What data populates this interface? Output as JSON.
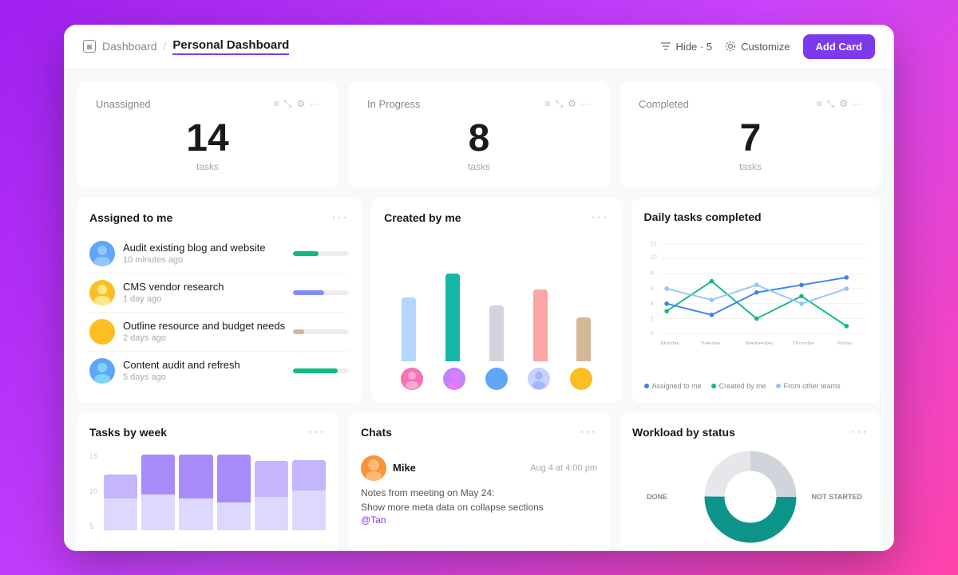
{
  "header": {
    "breadcrumb_root": "Dashboard",
    "breadcrumb_active": "Personal Dashboard",
    "hide_label": "Hide · 5",
    "customize_label": "Customize",
    "add_card_label": "Add Card"
  },
  "stats": [
    {
      "label": "Unassigned",
      "number": "14",
      "sub": "tasks"
    },
    {
      "label": "In Progress",
      "number": "8",
      "sub": "tasks"
    },
    {
      "label": "Completed",
      "number": "7",
      "sub": "tasks"
    }
  ],
  "assigned_to_me": {
    "title": "Assigned to me",
    "tasks": [
      {
        "name": "Audit existing blog and website",
        "time": "10 minutes ago",
        "progress": 45,
        "color": "#10b981"
      },
      {
        "name": "CMS vendor research",
        "time": "1 day ago",
        "progress": 55,
        "color": "#818cf8"
      },
      {
        "name": "Outline resource and budget needs",
        "time": "2 days ago",
        "progress": 20,
        "color": "#d4b896"
      },
      {
        "name": "Content audit and refresh",
        "time": "5 days ago",
        "progress": 80,
        "color": "#10b981"
      }
    ]
  },
  "created_by_me": {
    "title": "Created by me"
  },
  "daily_tasks": {
    "title": "Daily tasks completed",
    "legend": [
      {
        "label": "Assigned to me",
        "color": "#3b82f6"
      },
      {
        "label": "Created by me",
        "color": "#10b981"
      },
      {
        "label": "From other teams",
        "color": "#93c5fd"
      }
    ],
    "x_labels": [
      "Monday",
      "Tuesday",
      "Wednesday",
      "Thursday",
      "Friday"
    ]
  },
  "tasks_by_week": {
    "title": "Tasks by week",
    "y_labels": [
      "15",
      "10",
      "5"
    ]
  },
  "chats": {
    "title": "Chats",
    "message": {
      "user": "Mike",
      "time": "Aug 4 at 4:00 pm",
      "lines": [
        "Notes from meeting on May 24:",
        "Show more meta data on collapse sections"
      ],
      "mention": "@Tan"
    }
  },
  "workload": {
    "title": "Workload by status",
    "labels": {
      "done": "DONE",
      "not_started": "NOT STARTED"
    }
  }
}
